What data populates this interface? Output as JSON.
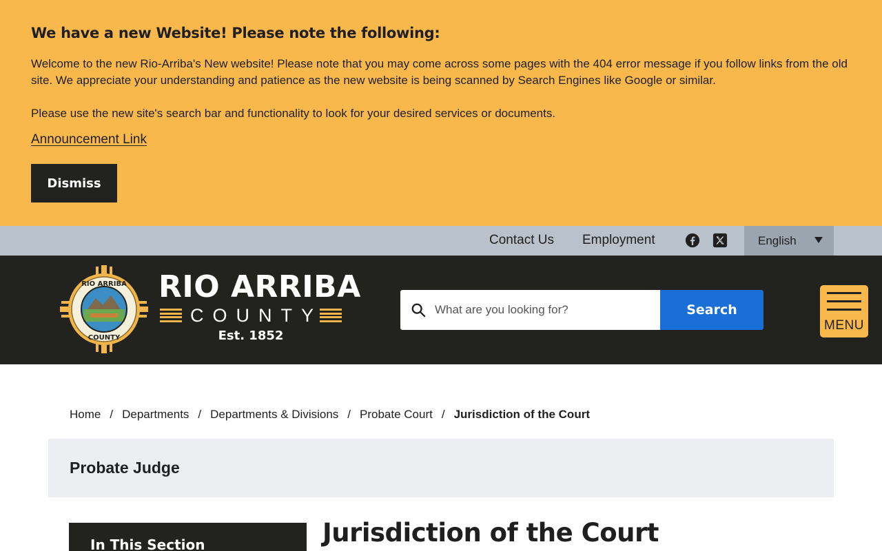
{
  "alert": {
    "title": "We have a new Website! Please note the following:",
    "paragraph_1": "Welcome to the new Rio-Arriba's New website! Please note that you may come across some pages with the 404 error message if you follow links from the old site. We appreciate your understanding and patience as the new website is being scanned by Search Engines like Google or similar.",
    "paragraph_2": "Please use the new site's search bar and functionality to look for your desired services or documents.",
    "link_label": "Announcement Link",
    "dismiss_label": "Dismiss"
  },
  "utility": {
    "contact_label": "Contact Us",
    "employment_label": "Employment",
    "social_icons": [
      "facebook-icon",
      "x-twitter-icon"
    ],
    "language": "English"
  },
  "header": {
    "brand_name": "RIO ARRIBA",
    "brand_county": "COUNTY",
    "brand_est": "Est. 1852",
    "seal_text": "RIO ARRIBA COUNTY",
    "search_placeholder": "What are you looking for?",
    "search_button": "Search",
    "menu_label": "MENU"
  },
  "breadcrumb": {
    "items": [
      "Home",
      "Departments",
      "Departments & Divisions",
      "Probate Court"
    ],
    "current": "Jurisdiction of the Court",
    "separator": "/"
  },
  "section": {
    "title": "Probate Judge"
  },
  "sidebar": {
    "title": "In This Section"
  },
  "content": {
    "heading": "Jurisdiction of the Court"
  },
  "colors": {
    "alert_bg": "#f8b84b",
    "utility_bg": "#b9c2cb",
    "header_bg": "#22231e",
    "search_button_bg": "#1a6fd6",
    "accent_gold": "#f1b54b"
  }
}
